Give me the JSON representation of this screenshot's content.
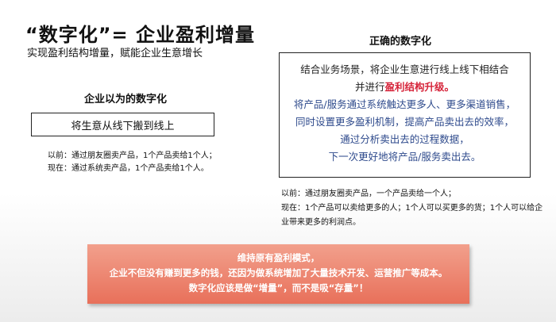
{
  "title": "“数字化”= 企业盈利增量",
  "subtitle": "实现盈利结构增量，赋能企业生意增长",
  "left": {
    "heading": "企业以为的数字化",
    "box_text": "将生意从线下搬到线上",
    "notes": [
      "以前：通过朋友圈卖产品，1个产品卖给1个人；",
      "现在：通过系统卖产品，1个产品卖给1个人。"
    ]
  },
  "right": {
    "heading": "正确的数字化",
    "box_line1": "结合业务场景，将企业生意进行线上线下相结合",
    "box_line2_prefix": "并进行",
    "box_line2_highlight": "盈利结构升级。",
    "box_blue_lines": [
      "将产品/服务通过系统触达更多人、更多渠道销售，",
      "同时设置更多盈利机制，提高产品卖出去的效率，",
      "通过分析卖出去的过程数据，",
      "下一次更好地将产品/服务卖出去。"
    ],
    "notes": [
      "以前：通过朋友圈卖产品，一个产品卖给一个人；",
      "现在：1个产品可以卖给更多的人；1个人可以买更多的货；1个人可以给企业带来更多的利润点。"
    ]
  },
  "banner": {
    "lines": [
      "维持原有盈利模式，",
      "企业不但没有赚到更多的钱，还因为做系统增加了大量技术开发、运营推广等成本。",
      "数字化应该是做“增量”，而不是吸“存量”！"
    ]
  },
  "colors": {
    "highlight_red": "#d6243a",
    "text_blue": "#2e4a8c",
    "banner_top": "#f2a08c",
    "banner_bottom": "#e8705a"
  }
}
